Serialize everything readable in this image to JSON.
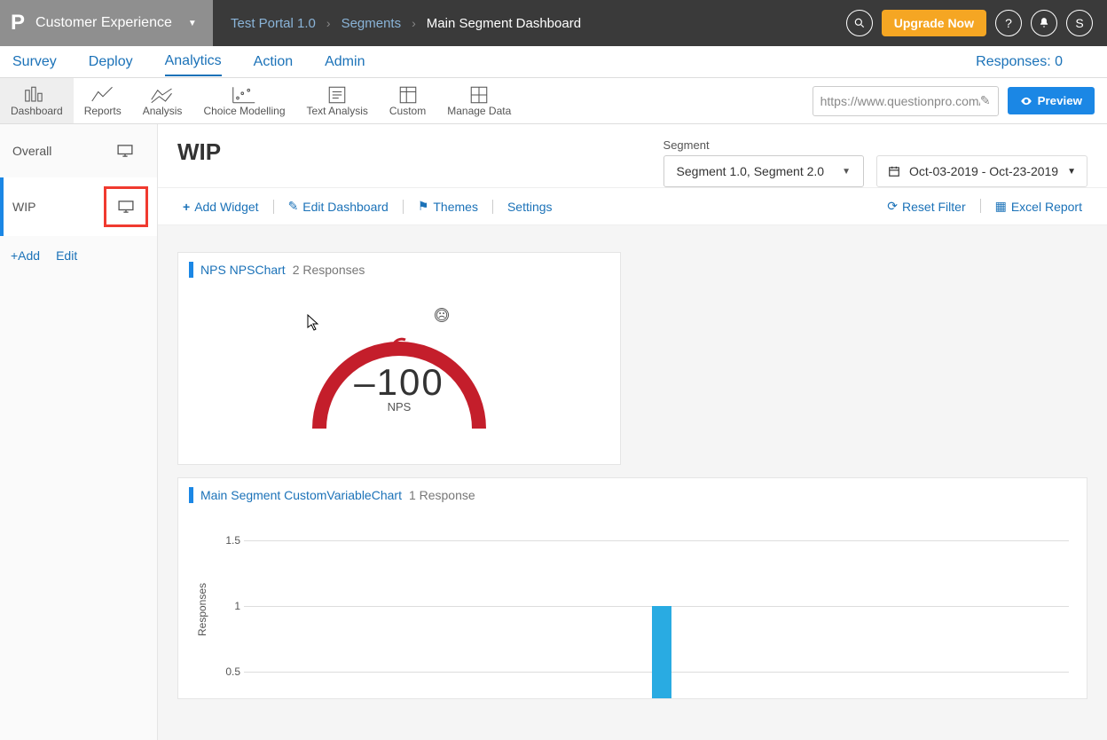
{
  "brand": {
    "logo": "P",
    "title": "Customer Experience"
  },
  "breadcrumbs": {
    "portal": "Test Portal 1.0",
    "section": "Segments",
    "current": "Main Segment Dashboard"
  },
  "topbar": {
    "upgrade": "Upgrade Now",
    "user_initial": "S"
  },
  "mainnav": {
    "items": [
      "Survey",
      "Deploy",
      "Analytics",
      "Action",
      "Admin"
    ],
    "active_index": 2,
    "responses": "Responses: 0"
  },
  "toolbar": {
    "items": [
      "Dashboard",
      "Reports",
      "Analysis",
      "Choice Modelling",
      "Text Analysis",
      "Custom",
      "Manage Data"
    ],
    "active_index": 0,
    "url": "https://www.questionpro.com/a/",
    "preview": "Preview"
  },
  "sidebar": {
    "items": [
      "Overall",
      "WIP"
    ],
    "active_index": 1,
    "add": "+Add",
    "edit": "Edit"
  },
  "page": {
    "title": "WIP",
    "segment_label": "Segment",
    "segment_value": "Segment 1.0, Segment 2.0",
    "date_range": "Oct-03-2019 - Oct-23-2019"
  },
  "actions": {
    "add_widget": "Add Widget",
    "edit_dashboard": "Edit Dashboard",
    "themes": "Themes",
    "settings": "Settings",
    "reset_filter": "Reset Filter",
    "excel_report": "Excel Report"
  },
  "widgets": {
    "nps": {
      "title": "NPS NPSChart",
      "subtitle": "2 Responses",
      "value": "–100",
      "unit": "NPS"
    },
    "bar": {
      "title": "Main Segment CustomVariableChart",
      "subtitle": "1 Response"
    }
  },
  "chart_data": [
    {
      "type": "bar",
      "title": "Main Segment CustomVariableChart",
      "ylabel": "Responses",
      "ylim": [
        0,
        1.5
      ],
      "yticks": [
        0.5,
        1,
        1.5
      ],
      "categories": [
        ""
      ],
      "values": [
        1
      ]
    }
  ]
}
